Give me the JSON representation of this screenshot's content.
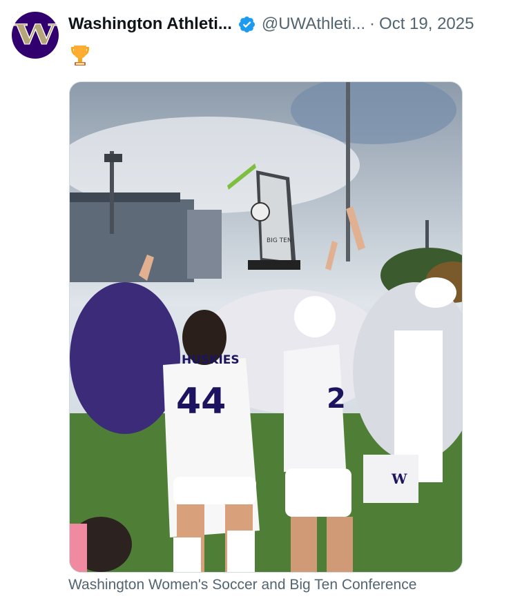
{
  "post": {
    "author": {
      "avatar_letter": "W",
      "display_name": "Washington Athleti...",
      "handle": "@UWAthleti...",
      "verified": true
    },
    "separator": "·",
    "date": "Oct 19, 2025",
    "text_emoji": "trophy-icon",
    "media": {
      "alt_caption": "Washington Women's Soccer and Big Ten Conference",
      "jersey_text": "HUSKIES",
      "jersey_numbers": [
        "44",
        "2"
      ],
      "trophy_label": "BIG TEN",
      "shorts_letter": "W"
    }
  },
  "colors": {
    "uw_purple": "#32006e",
    "uw_gold": "#b7a57a",
    "verified_blue": "#1d9bf0",
    "secondary_text": "#536471"
  }
}
